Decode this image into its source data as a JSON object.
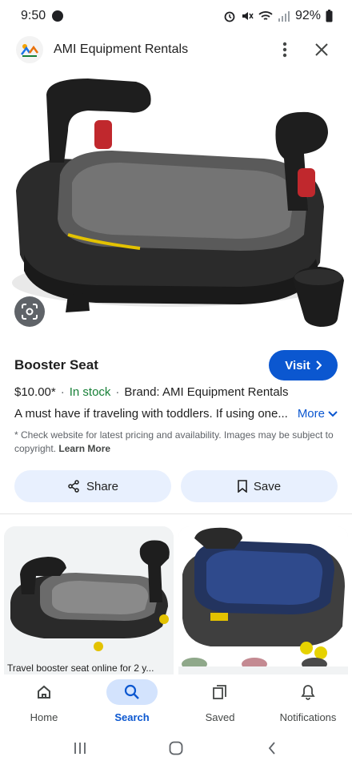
{
  "status_bar": {
    "time": "9:50",
    "battery": "92%"
  },
  "header": {
    "site_name": "AMI Equipment Rentals",
    "logo_icon": "ami-logo",
    "menu_icon": "more-vert-icon",
    "close_icon": "close-icon"
  },
  "hero": {
    "image_desc_icon": "booster-seat-image",
    "lens_icon": "google-lens-icon"
  },
  "product": {
    "title": "Booster Seat",
    "visit_label": "Visit",
    "price": "$10.00*",
    "stock": "In stock",
    "brand": "Brand: AMI Equipment Rentals",
    "description": "A must have if traveling with toddlers. If using one...",
    "more_label": "More",
    "disclaimer": "* Check website for latest pricing and availability. Images may be subject to copyright.",
    "learn_more": "Learn More"
  },
  "actions": {
    "share_label": "Share",
    "save_label": "Save"
  },
  "related": [
    {
      "caption": "Travel booster seat online for 2 y..."
    },
    {
      "caption": ""
    }
  ],
  "bottom_nav": {
    "items": [
      {
        "label": "Home",
        "icon": "home-icon"
      },
      {
        "label": "Search",
        "icon": "search-icon",
        "active": true
      },
      {
        "label": "Saved",
        "icon": "saved-icon"
      },
      {
        "label": "Notifications",
        "icon": "bell-icon"
      }
    ]
  },
  "colors": {
    "accent": "#0b57d0",
    "in_stock": "#188038",
    "pill_bg": "#e8f0fe",
    "active_nav_bg": "#d3e3fd"
  }
}
